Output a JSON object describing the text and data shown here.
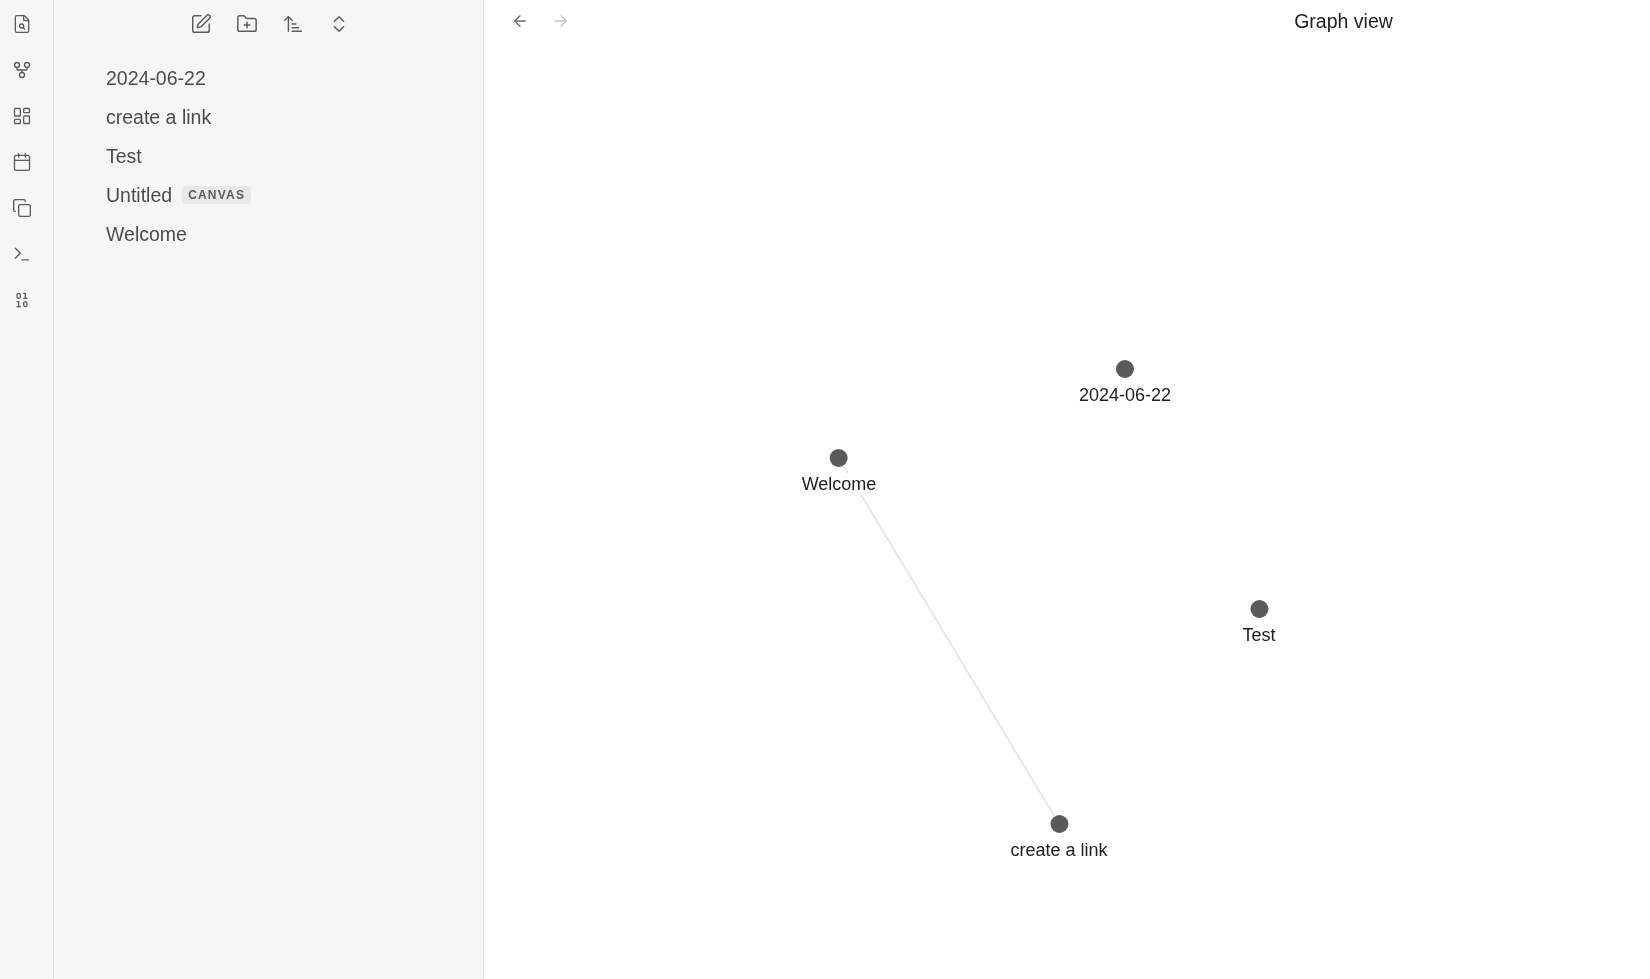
{
  "file_explorer": {
    "files": [
      {
        "name": "2024-06-22"
      },
      {
        "name": "create a link"
      },
      {
        "name": "Test"
      },
      {
        "name": "Untitled",
        "tag": "CANVAS"
      },
      {
        "name": "Welcome"
      }
    ]
  },
  "tab_header": {
    "nav_buttons": [
      {
        "kind": "back",
        "disabled": false
      },
      {
        "kind": "forward",
        "disabled": true
      }
    ],
    "title": "Graph view"
  },
  "graph": {
    "nodes": [
      {
        "label": "2024-06-22",
        "linked": false
      },
      {
        "label": "Welcome",
        "linked": true
      },
      {
        "label": "Test",
        "linked": false
      },
      {
        "label": "create a link",
        "linked": true
      }
    ]
  }
}
